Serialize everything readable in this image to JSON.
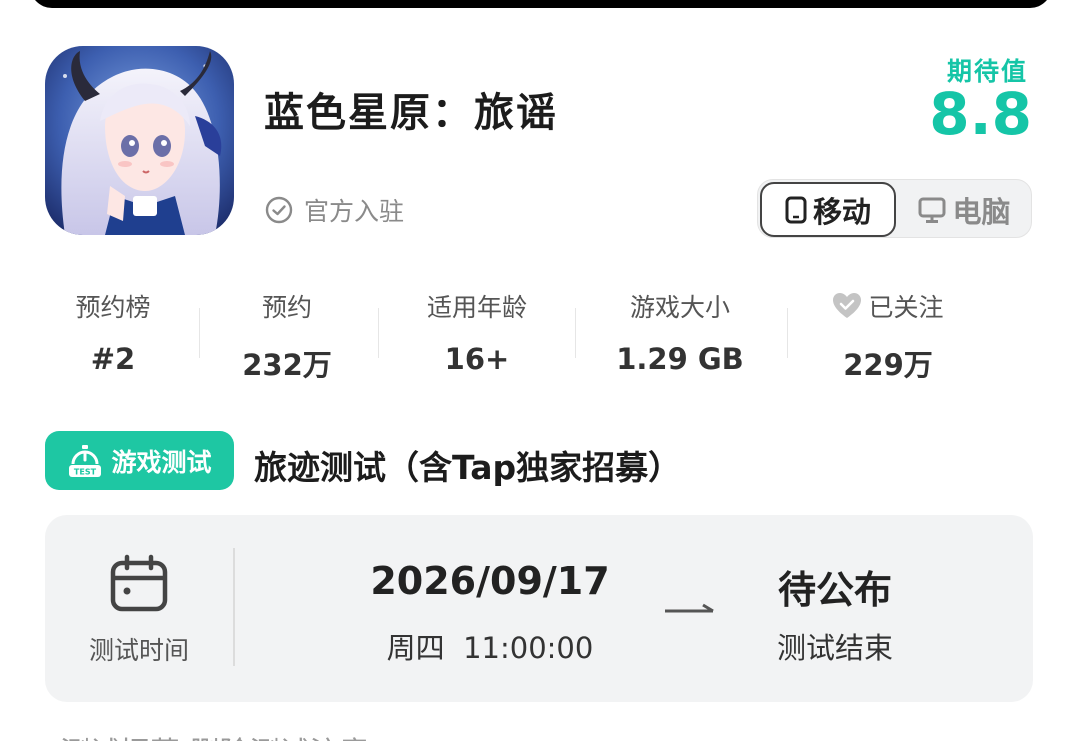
{
  "app": {
    "title": "蓝色星原：旅谣",
    "verified_text": "官方入驻",
    "icon_name": "app-icon-anime-girl"
  },
  "expectation": {
    "label": "期待值",
    "score": "8.8",
    "color": "#15c5a7"
  },
  "platform_toggle": {
    "mobile_label": "移动",
    "pc_label": "电脑",
    "selected": "mobile"
  },
  "stats": [
    {
      "label": "预约榜",
      "value": "#2"
    },
    {
      "label": "预约",
      "value": "232万"
    },
    {
      "label": "适用年龄",
      "value": "16+"
    },
    {
      "label": "游戏大小",
      "value": "1.29 GB"
    },
    {
      "label": "已关注",
      "value": "229万",
      "icon": "heart-check-icon"
    }
  ],
  "test": {
    "badge_label": "游戏测试",
    "badge_icon": "test-timer-icon",
    "badge_color": "#1ec7a3",
    "title": "旅迹测试（含Tap独家招募）",
    "card_label": "测试时间",
    "start_date": "2026/09/17",
    "start_time": "周四  11:00:00",
    "end_status": "待公布",
    "end_label": "测试结束"
  },
  "bottom_partial_text": "测试招募          删除测试注意"
}
